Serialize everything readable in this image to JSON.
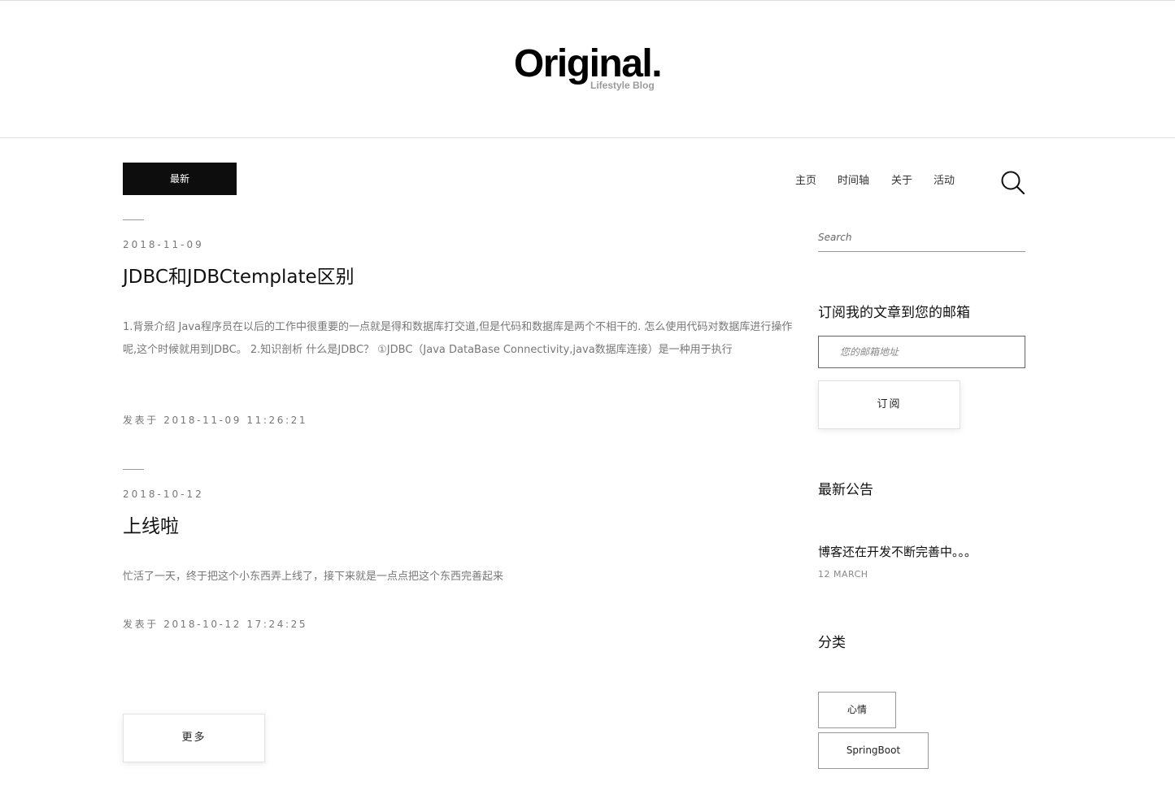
{
  "header": {
    "title": "Original.",
    "subtitle": "Lifestyle Blog"
  },
  "tabs": {
    "latest_label": "最新"
  },
  "nav": {
    "items": [
      {
        "label": "主页"
      },
      {
        "label": "时间轴"
      },
      {
        "label": "关于"
      },
      {
        "label": "活动"
      }
    ],
    "search_icon": "search-icon"
  },
  "posts": [
    {
      "date": "2018-11-09",
      "title": "JDBC和JDBCtemplate区别",
      "excerpt": "1.背景介绍 Java程序员在以后的工作中很重要的一点就是得和数据库打交道,但是代码和数据库是两个不相干的. 怎么使用代码对数据库进行操作呢,这个时候就用到JDBC。 2.知识剖析 什么是JDBC？ ①JDBC（Java DataBase Connectivity,java数据库连接）是一种用于执行",
      "meta": "发表于 2018-11-09 11:26:21"
    },
    {
      "date": "2018-10-12",
      "title": "上线啦",
      "excerpt": "忙活了一天，终于把这个小东西弄上线了，接下来就是一点点把这个东西完善起来",
      "meta": "发表于 2018-10-12 17:24:25"
    }
  ],
  "more_label": "更多",
  "sidebar": {
    "search_placeholder": "Search",
    "subscribe": {
      "title": "订阅我的文章到您的邮箱",
      "email_placeholder": "您的邮箱地址",
      "button_label": "订阅"
    },
    "notice": {
      "title": "最新公告",
      "text": "博客还在开发不断完善中。。。",
      "date": "12 MARCH"
    },
    "categories": {
      "title": "分类",
      "items": [
        {
          "label": "心情"
        },
        {
          "label": "SpringBoot"
        }
      ]
    }
  }
}
